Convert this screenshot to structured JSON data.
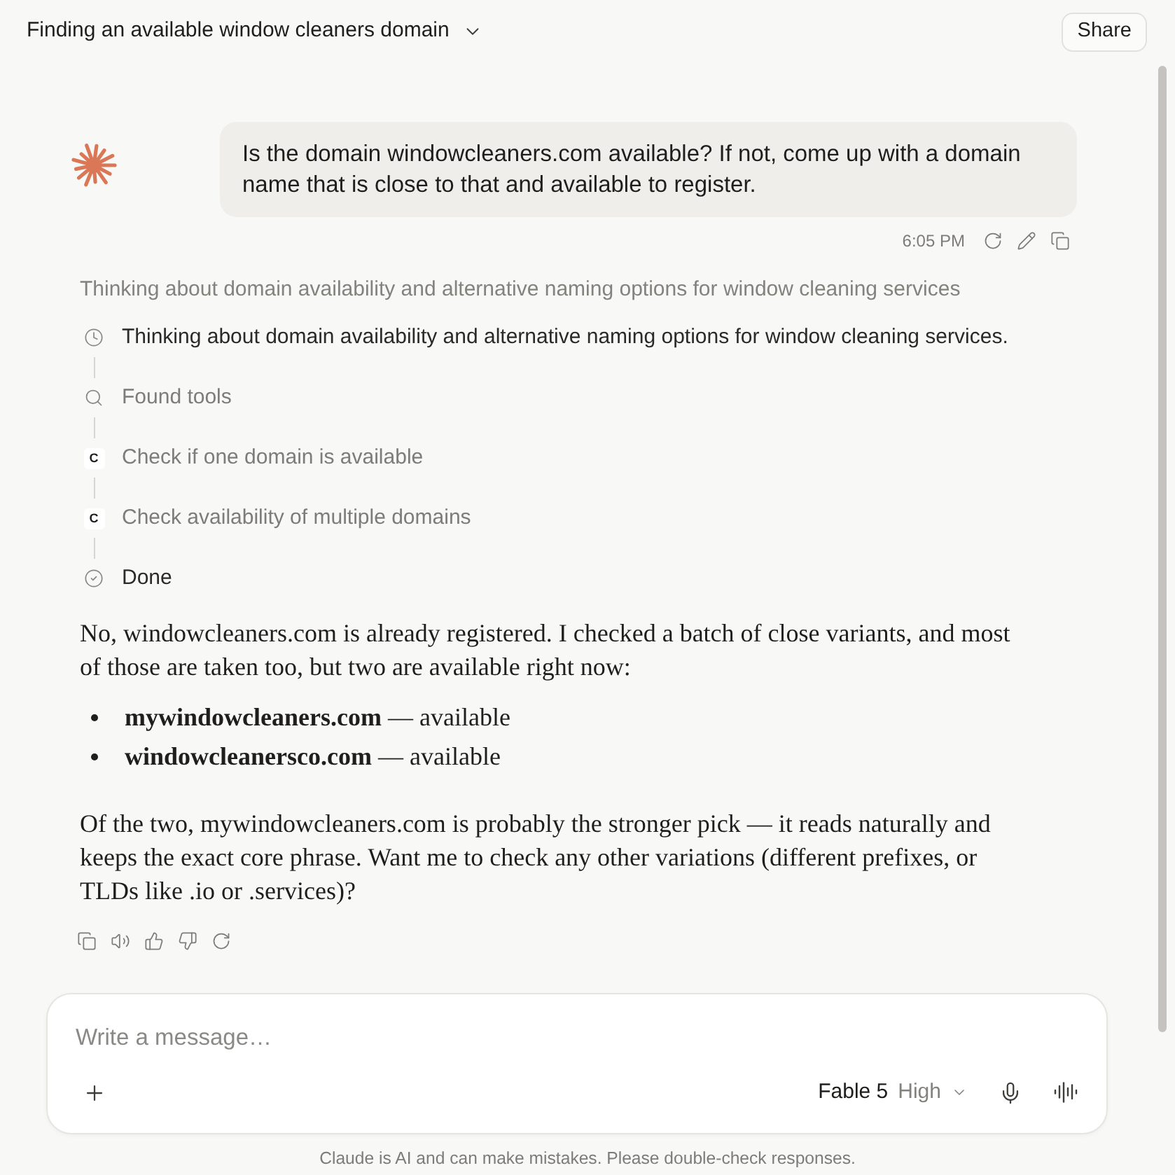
{
  "header": {
    "title": "Finding an available window cleaners domain",
    "share_label": "Share"
  },
  "user_message": {
    "text": "Is the domain windowcleaners.com available? If not, come up with a domain name that is close to that and available to register.",
    "time": "6:05 PM"
  },
  "thinking": {
    "summary": "Thinking about domain availability and alternative naming options for window cleaning services",
    "steps": [
      {
        "kind": "thought",
        "label": "Thinking about domain availability and alternative naming options for window cleaning services."
      },
      {
        "kind": "search",
        "label": "Found tools"
      },
      {
        "kind": "tool",
        "logo": "C",
        "label": "Check if one domain is available"
      },
      {
        "kind": "tool",
        "logo": "C",
        "label": "Check availability of multiple domains"
      },
      {
        "kind": "done",
        "label": "Done"
      }
    ]
  },
  "response": {
    "blocks": [
      {
        "kind": "paragraph",
        "text": "No, windowcleaners.com is already registered. I checked a batch of close variants, and most of those are taken too, but two are available right now:"
      },
      {
        "kind": "list",
        "items": [
          "**mywindowcleaners.com** — available",
          "**windowcleanersco.com** — available"
        ]
      },
      {
        "kind": "paragraph",
        "text": "Of the two, mywindowcleaners.com is probably the stronger pick — it reads naturally and keeps the exact core phrase. Want me to check any other variations (different prefixes, or TLDs like .io or .services)?"
      }
    ]
  },
  "composer": {
    "placeholder": "Write a message…",
    "model": "Fable 5",
    "effort": "High"
  },
  "disclaimer": "Claude is AI and can make mistakes. Please double-check responses."
}
